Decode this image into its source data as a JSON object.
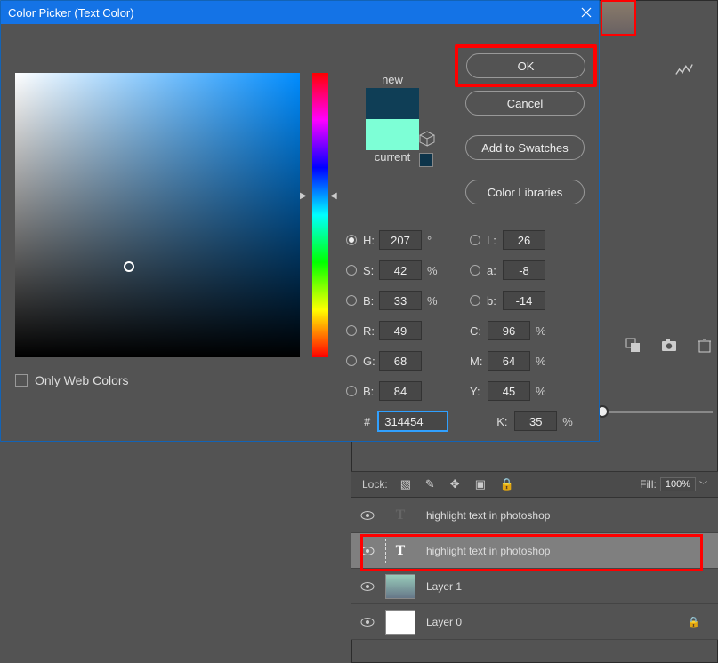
{
  "dialog": {
    "title": "Color Picker (Text Color)",
    "new_label": "new",
    "current_label": "current",
    "only_web_label": "Only Web Colors",
    "buttons": {
      "ok": "OK",
      "cancel": "Cancel",
      "add_swatches": "Add to Swatches",
      "color_lib": "Color Libraries"
    },
    "values": {
      "H": "207",
      "H_unit": "°",
      "S": "42",
      "S_unit": "%",
      "Bhsv": "33",
      "Bhsv_unit": "%",
      "L": "26",
      "a": "-8",
      "b": "-14",
      "R": "49",
      "G": "68",
      "Brgb": "84",
      "C": "96",
      "M": "64",
      "Y": "45",
      "K": "35",
      "hex": "314454"
    }
  },
  "panel": {
    "lock_label": "Lock:",
    "fill_label": "Fill:",
    "fill_value": "100%"
  },
  "layers": [
    {
      "name": "highlight text in photoshop",
      "type": "text",
      "selected": false
    },
    {
      "name": "highlight text in photoshop",
      "type": "text",
      "selected": true
    },
    {
      "name": "Layer 1",
      "type": "image",
      "selected": false
    },
    {
      "name": "Layer 0",
      "type": "white",
      "selected": false,
      "locked": true
    }
  ]
}
